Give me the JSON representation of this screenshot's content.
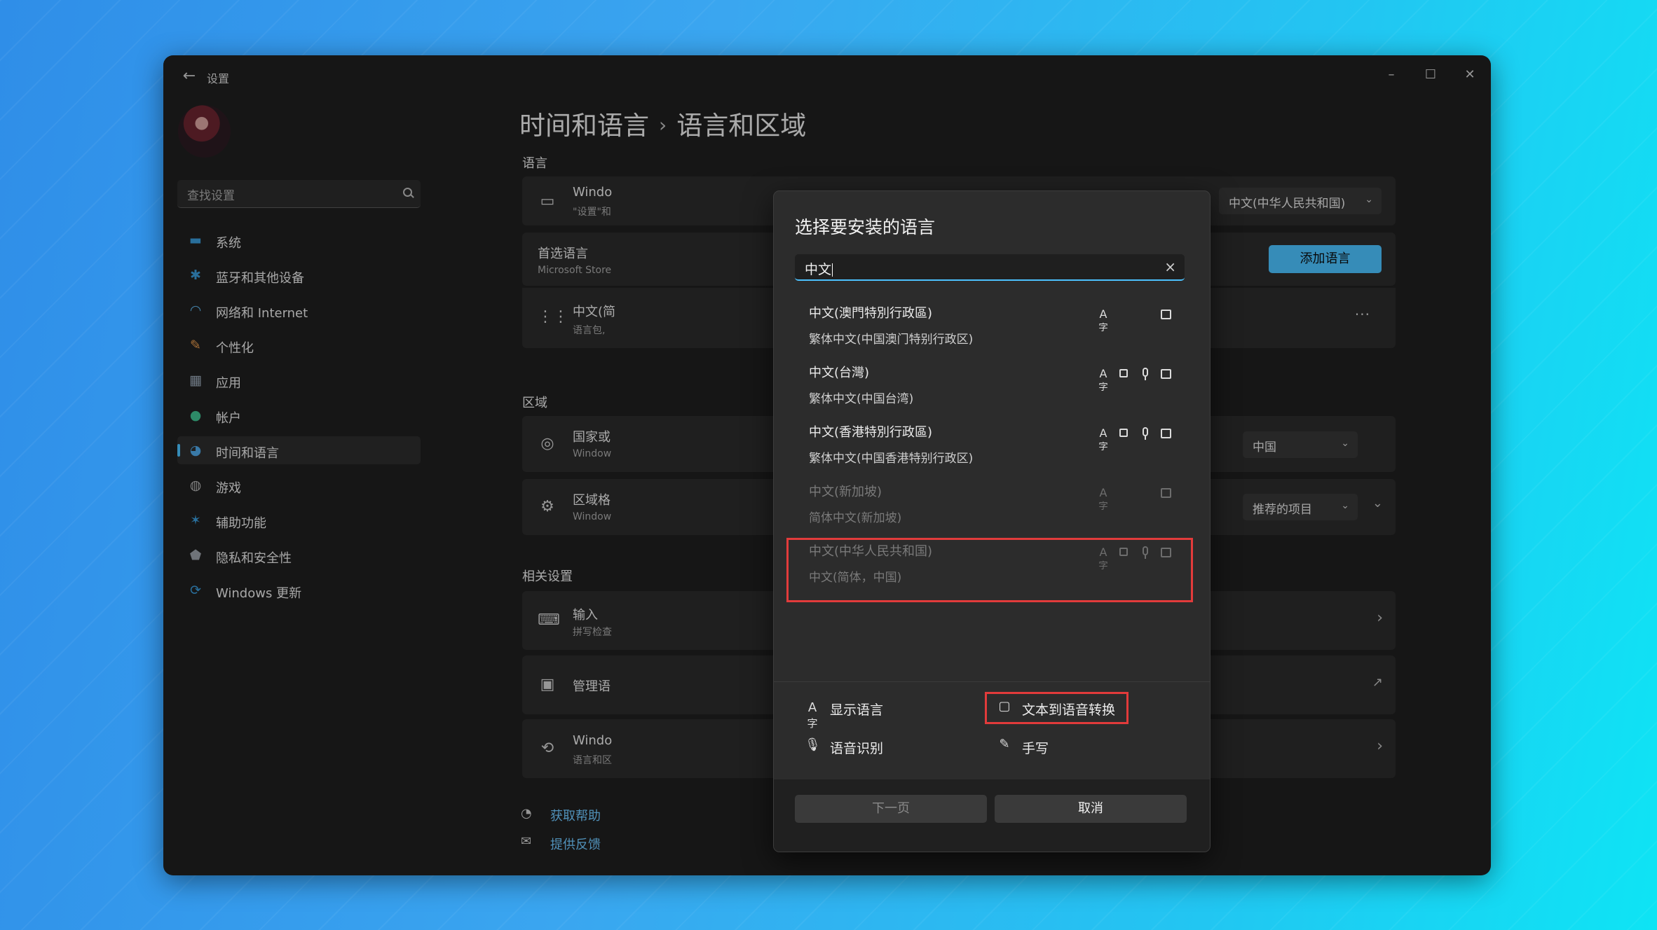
{
  "window": {
    "app_title": "设置",
    "controls": {
      "minimize": "–",
      "maximize": "☐",
      "close": "✕"
    }
  },
  "sidebar": {
    "search_placeholder": "查找设置",
    "items": [
      {
        "label": "系统",
        "icon": "monitor-icon",
        "active": false
      },
      {
        "label": "蓝牙和其他设备",
        "icon": "bluetooth-icon",
        "active": false
      },
      {
        "label": "网络和 Internet",
        "icon": "wifi-icon",
        "active": false
      },
      {
        "label": "个性化",
        "icon": "brush-icon",
        "active": false
      },
      {
        "label": "应用",
        "icon": "apps-icon",
        "active": false
      },
      {
        "label": "帐户",
        "icon": "person-icon",
        "active": false
      },
      {
        "label": "时间和语言",
        "icon": "globe-clock-icon",
        "active": true
      },
      {
        "label": "游戏",
        "icon": "gamepad-icon",
        "active": false
      },
      {
        "label": "辅助功能",
        "icon": "accessibility-icon",
        "active": false
      },
      {
        "label": "隐私和安全性",
        "icon": "shield-icon",
        "active": false
      },
      {
        "label": "Windows 更新",
        "icon": "refresh-icon",
        "active": false
      }
    ]
  },
  "main": {
    "breadcrumb": {
      "parent": "时间和语言",
      "separator": "›",
      "current": "语言和区域"
    },
    "sections": {
      "language": "语言",
      "region": "区域",
      "related": "相关设置"
    },
    "rows": {
      "windows_display": {
        "title": "Windo",
        "sub": "\"设置\"和",
        "value": "中文(中华人民共和国)"
      },
      "preferred": {
        "title": "首选语言",
        "sub": "Microsoft Store",
        "button": "添加语言"
      },
      "lang_entry": {
        "title": "中文(简",
        "sub": "语言包,",
        "more": "···"
      },
      "country": {
        "title": "国家或",
        "sub": "Window",
        "value": "中国"
      },
      "region_format": {
        "title": "区域格",
        "sub": "Window",
        "value": "推荐的项目"
      },
      "input": {
        "title": "输入",
        "sub": "拼写检查"
      },
      "manage": {
        "title": "管理语"
      },
      "windows_backup": {
        "title": "Windo",
        "sub": "语言和区"
      }
    },
    "links": {
      "help": "获取帮助",
      "feedback": "提供反馈"
    }
  },
  "dialog": {
    "title": "选择要安装的语言",
    "search_value": "中文",
    "languages": [
      {
        "name": "中文(澳門特別行政區)",
        "native": "繁体中文(中国澳门特别行政区)",
        "features": [
          "display",
          "handwriting"
        ],
        "disabled": false
      },
      {
        "name": "中文(台灣)",
        "native": "繁体中文(中国台湾)",
        "features": [
          "display",
          "tts",
          "speech",
          "handwriting"
        ],
        "disabled": false
      },
      {
        "name": "中文(香港特別行政區)",
        "native": "繁体中文(中国香港特别行政区)",
        "features": [
          "display",
          "tts",
          "speech",
          "handwriting"
        ],
        "disabled": false
      },
      {
        "name": "中文(新加坡)",
        "native": "简体中文(新加坡)",
        "features": [
          "display",
          "handwriting"
        ],
        "disabled": true
      },
      {
        "name": "中文(中华人民共和国)",
        "native": "中文(简体，中国)",
        "features": [
          "display",
          "tts",
          "speech",
          "handwriting"
        ],
        "disabled": true
      }
    ],
    "legend": {
      "display": "显示语言",
      "tts": "文本到语音转换",
      "speech": "语音识别",
      "handwriting": "手写"
    },
    "buttons": {
      "next": "下一页",
      "cancel": "取消"
    }
  },
  "colors": {
    "accent": "#4cc2ff",
    "highlight_box": "#e23b3b",
    "window_bg": "#1f1f1f"
  }
}
